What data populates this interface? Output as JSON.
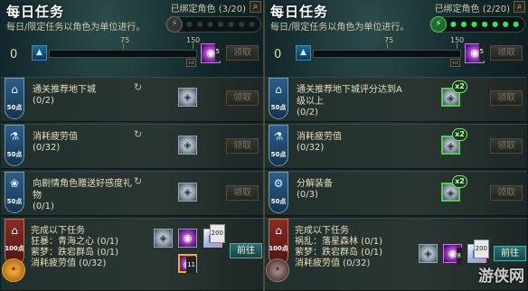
{
  "left": {
    "title": "每日任务",
    "subtitle": "每日/限定任务以角色为单位进行。",
    "bound": "已绑定角色 (3/20)",
    "search_icon": "magnifier-icon",
    "energy_state": "inactive",
    "zero": "0",
    "tick75": "75",
    "tick150": "150",
    "progress_fraction": 0.0,
    "reward_count": "5",
    "claim_label": "领取",
    "quests": [
      {
        "title": "通关推荐地下城",
        "count": "(0/2)",
        "points": "50点",
        "icon": "dungeon-icon",
        "claim": "领取"
      },
      {
        "title": "消耗疲劳值",
        "count": "(0/32)",
        "points": "50点",
        "icon": "fatigue-icon",
        "claim": "领取"
      },
      {
        "title": "向剧情角色赠送好感度礼物",
        "count": "(0/1)",
        "points": "50点",
        "icon": "gift-icon",
        "claim": "领取"
      }
    ],
    "final": {
      "title": "完成以下任务",
      "line1": "狂暴：青海之心 (0/1)",
      "line2": "萦梦：跌宕群岛 (0/1)",
      "line3": "消耗疲劳值 (0/32)",
      "points": "100点",
      "item_200": "200",
      "item_11": "11",
      "item_8": "8",
      "go_label": "前往"
    }
  },
  "right": {
    "title": "每日任务",
    "subtitle": "每日/限定任务以角色为单位进行。",
    "bound": "已绑定角色 (2/20)",
    "search_icon": "magnifier-icon",
    "energy_state": "active",
    "zero": "0",
    "tick75": "75",
    "tick150": "150",
    "progress_fraction": 0.0,
    "reward_count": "5",
    "claim_label": "领取",
    "quests": [
      {
        "title": "通关推荐地下城评分达到A级以上",
        "count": "(0/2)",
        "points": "50点",
        "icon": "dungeon-icon",
        "claim": "领取",
        "badge": "x2"
      },
      {
        "title": "消耗疲劳值",
        "count": "(0/32)",
        "points": "50点",
        "icon": "fatigue-icon",
        "claim": "领取",
        "badge": "x2"
      },
      {
        "title": "分解装备",
        "count": "(0/3)",
        "points": "50点",
        "icon": "gear-icon",
        "claim": "领取",
        "badge": "x2"
      }
    ],
    "final": {
      "title": "完成以下任务",
      "line1": "祸乱：落星森林 (0/1)",
      "line2": "萦梦：跌宕群岛 (0/1)",
      "line3": "消耗疲劳值 (0/32)",
      "points": "100点",
      "item_8": "8",
      "item_200": "200",
      "go_label": "前往"
    }
  },
  "watermark": "游侠网"
}
